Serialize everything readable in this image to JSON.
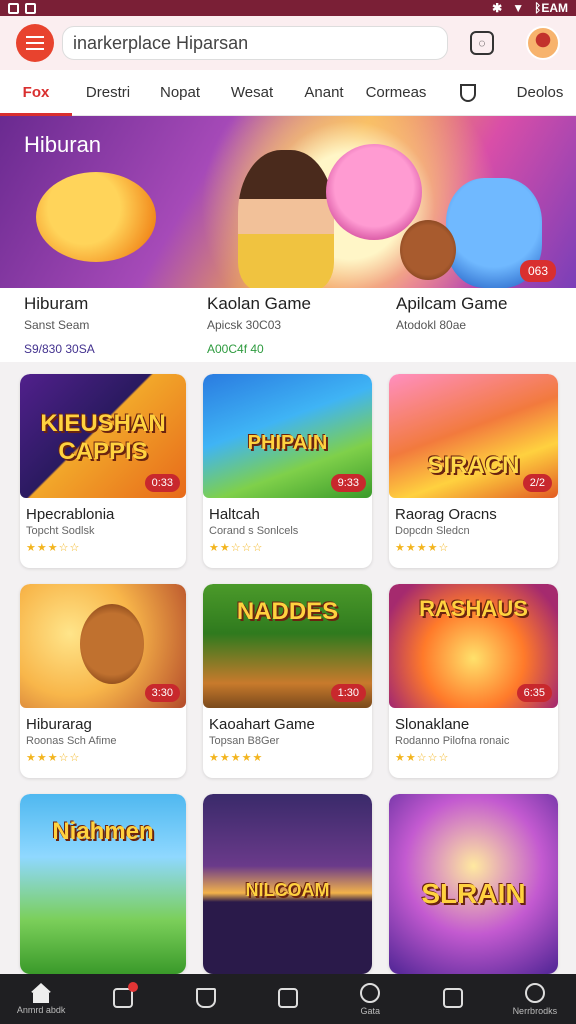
{
  "status_bar": {
    "right_text": "ᛒEAM"
  },
  "header": {
    "search_value": "inarkerplace Hiparsan"
  },
  "tabs": [
    {
      "label": "Fox",
      "active": true
    },
    {
      "label": "Drestri"
    },
    {
      "label": "Nopat"
    },
    {
      "label": "Wesat"
    },
    {
      "label": "Anant"
    },
    {
      "label": "Cormeas"
    },
    {
      "label": "",
      "icon": "shield-icon"
    },
    {
      "label": "Deolos"
    }
  ],
  "hero": {
    "title": "Hiburan",
    "badge": "063"
  },
  "featured": [
    {
      "name": "Hiburam",
      "sub": "Sanst Seam",
      "meta": "S9/830 30SA"
    },
    {
      "name": "Kaolan Game",
      "sub": "Apicsk 30C03",
      "meta": "A00C4f 40"
    },
    {
      "name": "Apilcam Game",
      "sub": "Atodokl 80ae",
      "meta": ""
    }
  ],
  "cards": [
    {
      "title_art": "KIEUSHAN CAPPIS",
      "badge": "0:33",
      "name": "Hpecrablonia",
      "sub": "Topcht Sodlsk",
      "stars": "★★★☆☆"
    },
    {
      "title_art": "PHIPAIN",
      "badge": "9:33",
      "name": "Haltcah",
      "sub": "Corand s Sonlcels",
      "stars": "★★☆☆☆"
    },
    {
      "title_art": "SIRACN",
      "badge": "2/2",
      "name": "Raorag Oracns",
      "sub": "Dopcdn Sledcn",
      "stars": "★★★★☆"
    },
    {
      "title_art": "",
      "badge": "3:30",
      "name": "Hiburarag",
      "sub": "Roonas Sch Afime",
      "stars": "★★★☆☆"
    },
    {
      "title_art": "NADDES",
      "badge": "1:30",
      "name": "Kaoahart Game",
      "sub": "Topsan B8Ger",
      "stars": "★★★★★"
    },
    {
      "title_art": "RASHAUS",
      "badge": "6:35",
      "name": "Slonaklane",
      "sub": "Rodanno Pilofna ronaic",
      "stars": "★★☆☆☆"
    },
    {
      "title_art": "Niahmen",
      "badge": "",
      "name": "",
      "sub": "",
      "stars": ""
    },
    {
      "title_art": "NILCOAM",
      "badge": "",
      "name": "",
      "sub": "",
      "stars": ""
    },
    {
      "title_art": "SLRAIN",
      "badge": "",
      "name": "",
      "sub": "",
      "stars": ""
    }
  ],
  "bottom_nav": [
    {
      "label": "Anmrd abdk",
      "icon": "home-icon"
    },
    {
      "label": "",
      "icon": "notifications-icon"
    },
    {
      "label": "",
      "icon": "hat-icon"
    },
    {
      "label": "",
      "icon": "bookmark-icon"
    },
    {
      "label": "Gata",
      "icon": "search-icon"
    },
    {
      "label": "",
      "icon": "calendar-icon"
    },
    {
      "label": "Nerrbrodks",
      "icon": "profile-icon"
    }
  ]
}
